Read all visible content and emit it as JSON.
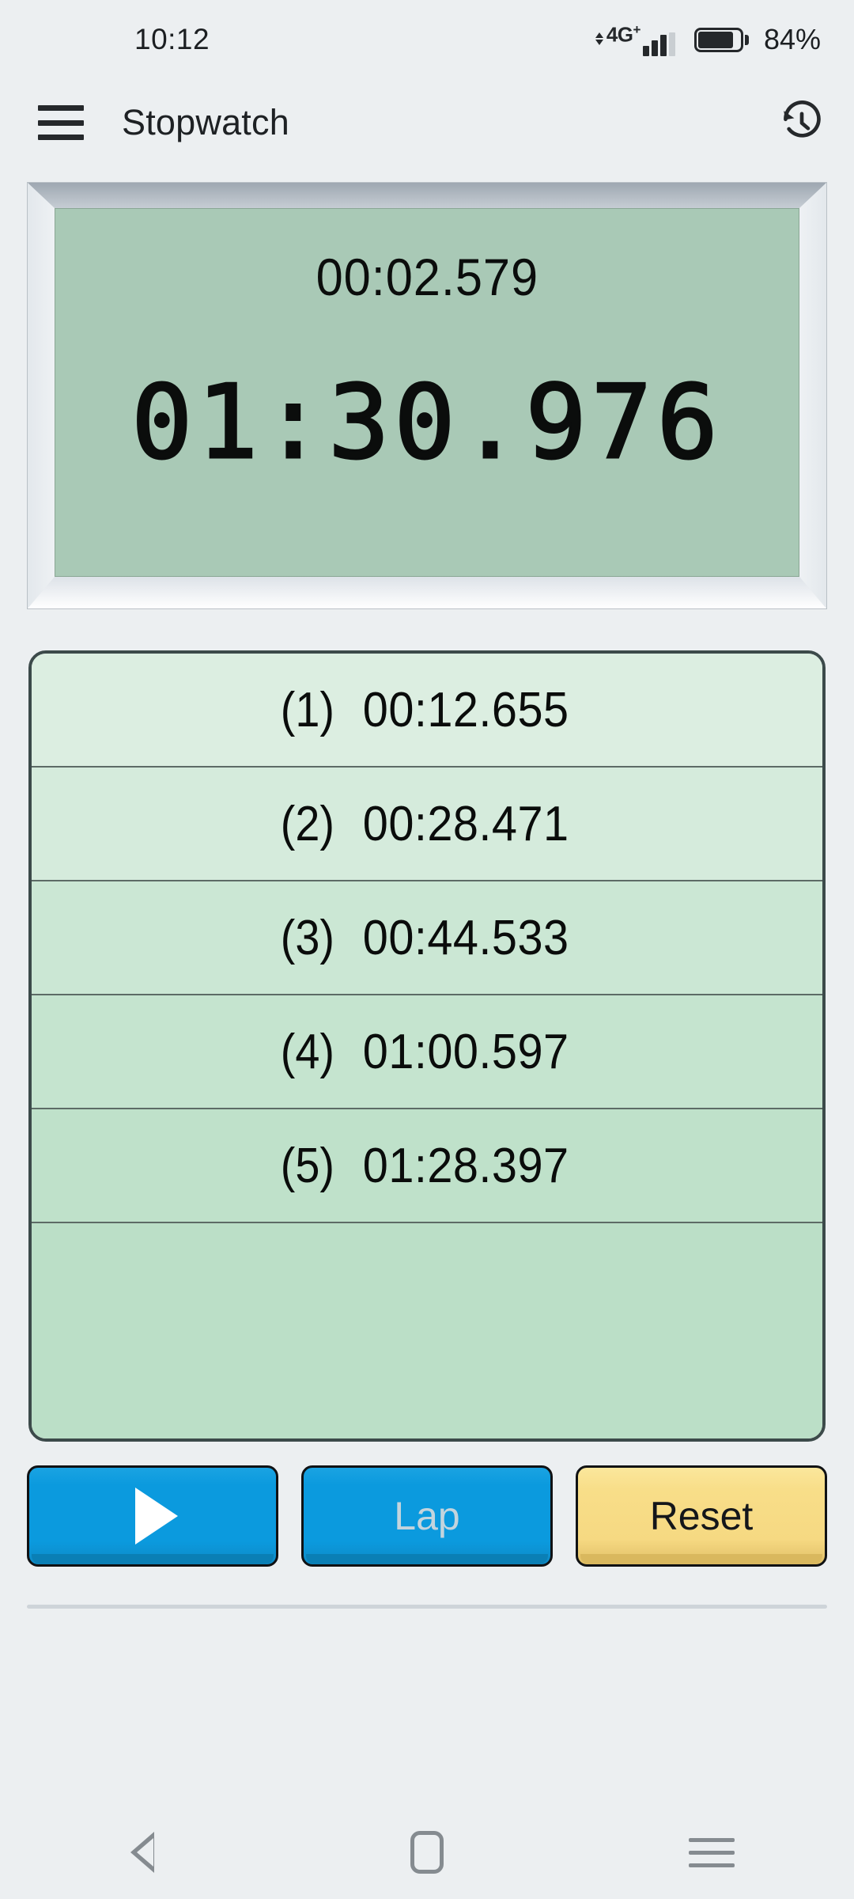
{
  "status_bar": {
    "time": "10:12",
    "network_label": "4G",
    "network_sup": "+",
    "battery_percent": "84%",
    "icons": {
      "data_arrows": "data-transfer-icon",
      "signal": "signal-bars-icon",
      "battery": "battery-icon"
    }
  },
  "app_bar": {
    "menu_icon": "hamburger-menu-icon",
    "title": "Stopwatch",
    "history_icon": "history-clock-icon"
  },
  "display": {
    "lap_time": "00:02.579",
    "main_time": "01:30.976",
    "screen_color": "#a9c9b6",
    "digit_color": "#0b0d0c"
  },
  "laps": {
    "rows": [
      {
        "index": "(1)",
        "time": "00:12.655",
        "bg": "#dceee1"
      },
      {
        "index": "(2)",
        "time": "00:28.471",
        "bg": "#d5ebdc"
      },
      {
        "index": "(3)",
        "time": "00:44.533",
        "bg": "#cbe7d4"
      },
      {
        "index": "(4)",
        "time": "01:00.597",
        "bg": "#c5e4cf"
      },
      {
        "index": "(5)",
        "time": "01:28.397",
        "bg": "#bfe1ca"
      }
    ],
    "empty_bg": "#bbdfc7",
    "border_color": "#3c4a4a"
  },
  "controls": {
    "start": {
      "icon": "play-icon",
      "label": "",
      "color": "#0b9ade"
    },
    "lap": {
      "label": "Lap",
      "color": "#0b9ade",
      "text_color": "#c3d4dd"
    },
    "reset": {
      "label": "Reset",
      "color": "#f6d982",
      "text_color": "#14161a"
    }
  },
  "nav_bar": {
    "back": "back-triangle-icon",
    "home": "home-square-icon",
    "recents": "recents-menu-icon"
  }
}
